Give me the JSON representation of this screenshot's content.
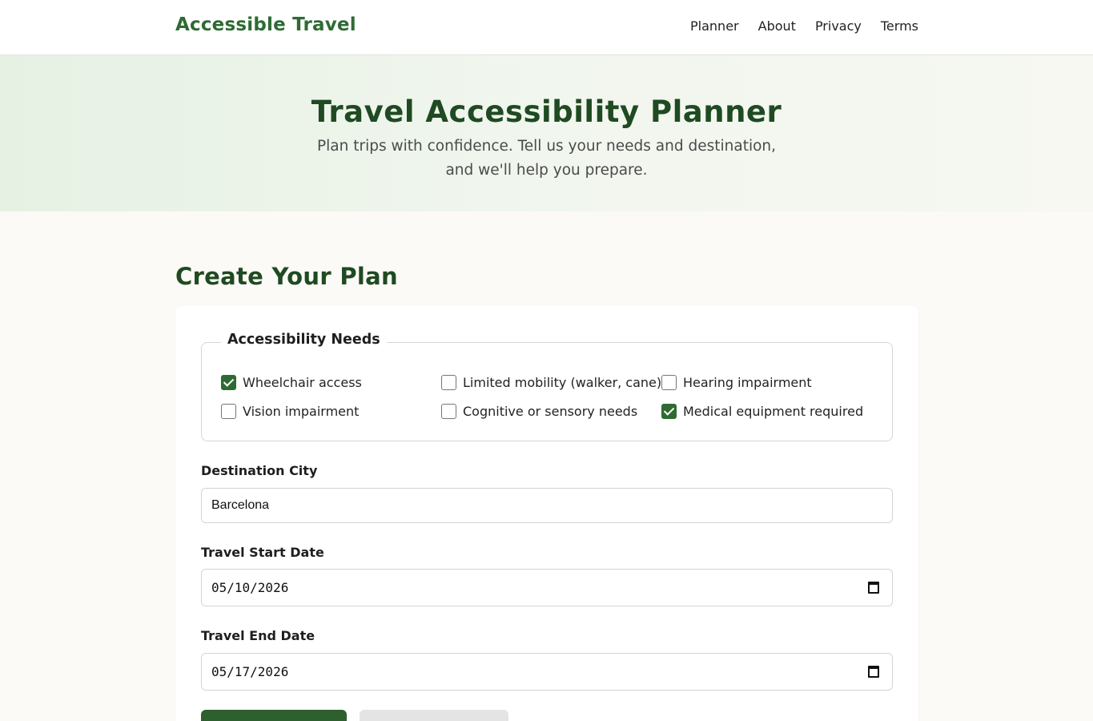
{
  "nav": {
    "brand": "Accessible Travel",
    "links": [
      "Planner",
      "About",
      "Privacy",
      "Terms"
    ]
  },
  "hero": {
    "title": "Travel Accessibility Planner",
    "subtitle_line1": "Plan trips with confidence. Tell us your needs and destination,",
    "subtitle_line2": "and we'll help you prepare."
  },
  "form": {
    "section_title": "Create Your Plan",
    "needs_legend": "Accessibility Needs",
    "needs": [
      {
        "label": "Wheelchair access",
        "checked": true
      },
      {
        "label": "Limited mobility (walker, cane)",
        "checked": false
      },
      {
        "label": "Hearing impairment",
        "checked": false
      },
      {
        "label": "Vision impairment",
        "checked": false
      },
      {
        "label": "Cognitive or sensory needs",
        "checked": false
      },
      {
        "label": "Medical equipment required",
        "checked": true
      }
    ],
    "destination_label": "Destination City",
    "destination_value": "Barcelona",
    "start_label": "Travel Start Date",
    "start_value": "05/10/2026",
    "end_label": "Travel End Date",
    "end_value": "05/17/2026"
  },
  "colors": {
    "brand_green": "#2e6b33",
    "heading_green": "#1f4a22",
    "checkbox_checked": "#2e6b33"
  }
}
